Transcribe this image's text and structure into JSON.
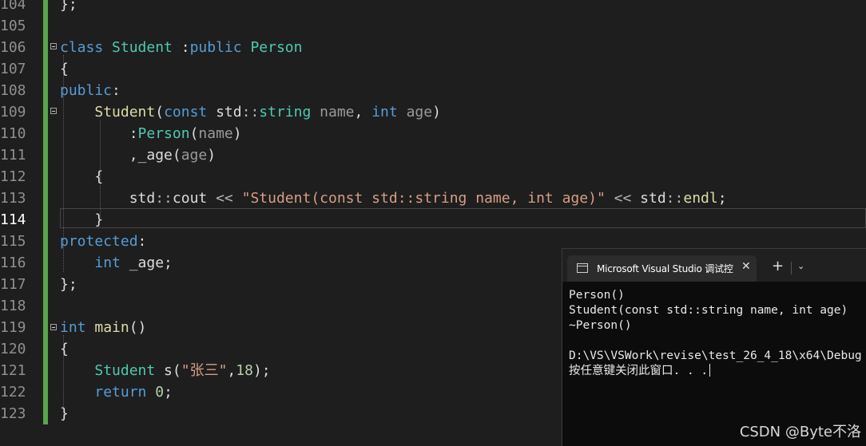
{
  "editor": {
    "current_line": "114",
    "lines": [
      {
        "num": "104",
        "segments": [
          {
            "t": "};",
            "c": ""
          }
        ]
      },
      {
        "num": "105",
        "segments": []
      },
      {
        "num": "106",
        "segments": [
          {
            "t": "class",
            "c": "kw"
          },
          {
            "t": " ",
            "c": ""
          },
          {
            "t": "Student",
            "c": "ty"
          },
          {
            "t": " :",
            "c": ""
          },
          {
            "t": "public",
            "c": "kw"
          },
          {
            "t": " ",
            "c": ""
          },
          {
            "t": "Person",
            "c": "ty"
          }
        ]
      },
      {
        "num": "107",
        "segments": [
          {
            "t": "{",
            "c": ""
          }
        ]
      },
      {
        "num": "108",
        "segments": [
          {
            "t": "public",
            "c": "kw"
          },
          {
            "t": ":",
            "c": ""
          }
        ]
      },
      {
        "num": "109",
        "segments": [
          {
            "t": "    ",
            "c": ""
          },
          {
            "t": "Student",
            "c": "fn"
          },
          {
            "t": "(",
            "c": ""
          },
          {
            "t": "const",
            "c": "kw"
          },
          {
            "t": " std",
            "c": ""
          },
          {
            "t": "::",
            "c": "op"
          },
          {
            "t": "string",
            "c": "ty"
          },
          {
            "t": " ",
            "c": ""
          },
          {
            "t": "name",
            "c": "pm"
          },
          {
            "t": ", ",
            "c": ""
          },
          {
            "t": "int",
            "c": "kw"
          },
          {
            "t": " ",
            "c": ""
          },
          {
            "t": "age",
            "c": "pm"
          },
          {
            "t": ")",
            "c": ""
          }
        ]
      },
      {
        "num": "110",
        "segments": [
          {
            "t": "        :",
            "c": ""
          },
          {
            "t": "Person",
            "c": "ty"
          },
          {
            "t": "(",
            "c": ""
          },
          {
            "t": "name",
            "c": "pm"
          },
          {
            "t": ")",
            "c": ""
          }
        ]
      },
      {
        "num": "111",
        "segments": [
          {
            "t": "        ,_age(",
            "c": ""
          },
          {
            "t": "age",
            "c": "pm"
          },
          {
            "t": ")",
            "c": ""
          }
        ]
      },
      {
        "num": "112",
        "segments": [
          {
            "t": "    {",
            "c": ""
          }
        ]
      },
      {
        "num": "113",
        "segments": [
          {
            "t": "        std",
            "c": ""
          },
          {
            "t": "::",
            "c": "op"
          },
          {
            "t": "cout ",
            "c": ""
          },
          {
            "t": "<<",
            "c": "op"
          },
          {
            "t": " ",
            "c": ""
          },
          {
            "t": "\"Student(const std::string name, int age)\"",
            "c": "st"
          },
          {
            "t": " ",
            "c": ""
          },
          {
            "t": "<<",
            "c": "op"
          },
          {
            "t": " std",
            "c": ""
          },
          {
            "t": "::",
            "c": "op"
          },
          {
            "t": "endl",
            "c": "fn"
          },
          {
            "t": ";",
            "c": ""
          }
        ]
      },
      {
        "num": "114",
        "segments": [
          {
            "t": "    }",
            "c": ""
          }
        ]
      },
      {
        "num": "115",
        "segments": [
          {
            "t": "protected",
            "c": "kw"
          },
          {
            "t": ":",
            "c": ""
          }
        ]
      },
      {
        "num": "116",
        "segments": [
          {
            "t": "    ",
            "c": ""
          },
          {
            "t": "int",
            "c": "kw"
          },
          {
            "t": " _age;",
            "c": ""
          }
        ]
      },
      {
        "num": "117",
        "segments": [
          {
            "t": "};",
            "c": ""
          }
        ]
      },
      {
        "num": "118",
        "segments": []
      },
      {
        "num": "119",
        "segments": [
          {
            "t": "int",
            "c": "kw"
          },
          {
            "t": " ",
            "c": ""
          },
          {
            "t": "main",
            "c": "fn"
          },
          {
            "t": "()",
            "c": ""
          }
        ]
      },
      {
        "num": "120",
        "segments": [
          {
            "t": "{",
            "c": ""
          }
        ]
      },
      {
        "num": "121",
        "segments": [
          {
            "t": "    ",
            "c": ""
          },
          {
            "t": "Student",
            "c": "ty"
          },
          {
            "t": " s(",
            "c": ""
          },
          {
            "t": "\"张三\"",
            "c": "st"
          },
          {
            "t": ",",
            "c": ""
          },
          {
            "t": "18",
            "c": "nu"
          },
          {
            "t": ");",
            "c": ""
          }
        ]
      },
      {
        "num": "122",
        "segments": [
          {
            "t": "    ",
            "c": ""
          },
          {
            "t": "return",
            "c": "kw"
          },
          {
            "t": " ",
            "c": ""
          },
          {
            "t": "0",
            "c": "nu"
          },
          {
            "t": ";",
            "c": ""
          }
        ]
      },
      {
        "num": "123",
        "segments": [
          {
            "t": "}",
            "c": ""
          }
        ]
      }
    ]
  },
  "console": {
    "tab_title": "Microsoft Visual Studio 调试控",
    "close_glyph": "✕",
    "new_tab_glyph": "+",
    "dropdown_glyph": "⌄",
    "output": [
      "Person()",
      "Student(const std::string name, int age)",
      "~Person()",
      "",
      "D:\\VS\\VSWork\\revise\\test_26_4_18\\x64\\Debug",
      "按任意键关闭此窗口. . ."
    ]
  },
  "watermark": "CSDN @Byte不洛"
}
